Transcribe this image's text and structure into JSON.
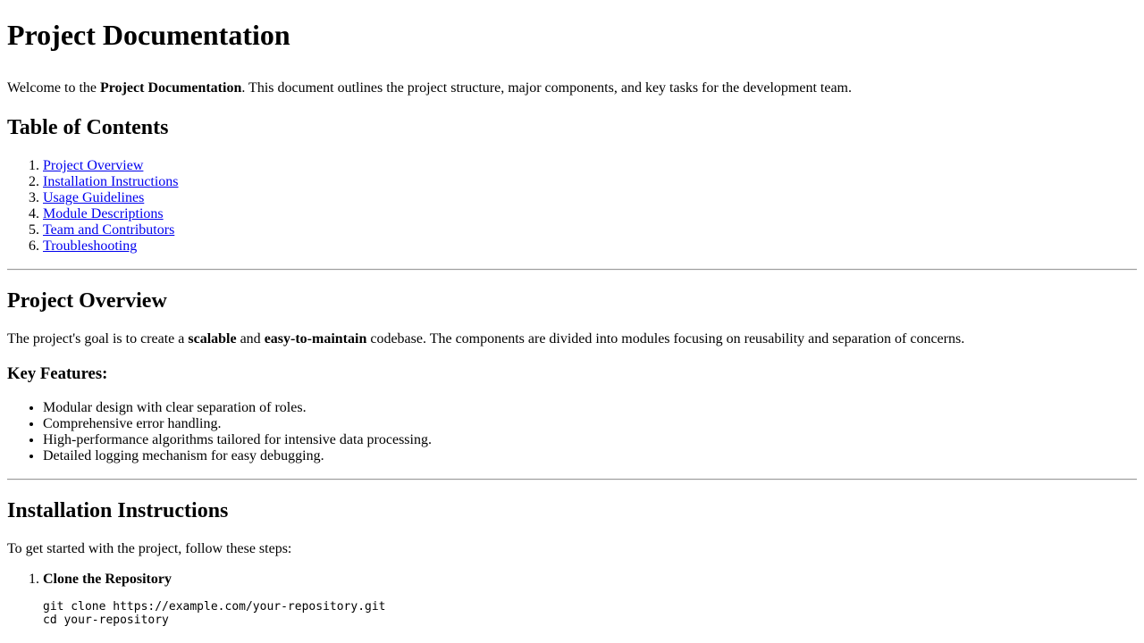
{
  "title": "Project Documentation",
  "intro": {
    "before": "Welcome to the ",
    "bold": "Project Documentation",
    "after": ". This document outlines the project structure, major components, and key tasks for the development team."
  },
  "toc": {
    "heading": "Table of Contents",
    "items": [
      "Project Overview",
      "Installation Instructions",
      "Usage Guidelines",
      "Module Descriptions",
      "Team and Contributors",
      "Troubleshooting"
    ]
  },
  "overview": {
    "heading": "Project Overview",
    "text_1": "The project's goal is to create a ",
    "bold_1": "scalable",
    "text_2": " and ",
    "bold_2": "easy-to-maintain",
    "text_3": " codebase. The components are divided into modules focusing on reusability and separation of concerns.",
    "features_heading": "Key Features:",
    "features": [
      "Modular design with clear separation of roles.",
      "Comprehensive error handling.",
      "High-performance algorithms tailored for intensive data processing.",
      "Detailed logging mechanism for easy debugging."
    ]
  },
  "installation": {
    "heading": "Installation Instructions",
    "text": "To get started with the project, follow these steps:",
    "steps": [
      {
        "title": "Clone the Repository",
        "code": "git clone https://example.com/your-repository.git\ncd your-repository"
      }
    ]
  }
}
